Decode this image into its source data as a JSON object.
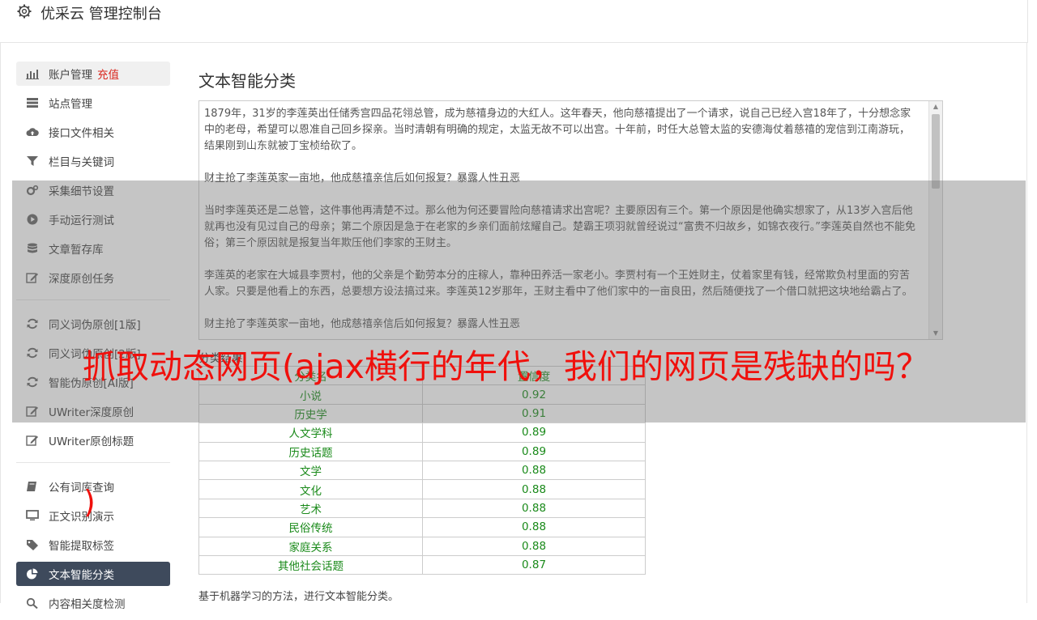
{
  "header": {
    "title": "优采云 管理控制台"
  },
  "sidebar": {
    "group1": [
      {
        "label": "账户管理",
        "extra": "充值",
        "icon": "bar-chart-icon"
      },
      {
        "label": "站点管理",
        "icon": "server-icon"
      },
      {
        "label": "接口文件相关",
        "icon": "cloud-upload-icon"
      },
      {
        "label": "栏目与关键词",
        "icon": "filter-icon"
      },
      {
        "label": "采集细节设置",
        "icon": "gears-icon"
      },
      {
        "label": "手动运行测试",
        "icon": "play-icon"
      },
      {
        "label": "文章暂存库",
        "icon": "database-icon"
      },
      {
        "label": "深度原创任务",
        "icon": "edit-icon"
      }
    ],
    "group2": [
      {
        "label": "同义词伪原创[1版]",
        "icon": "refresh-icon"
      },
      {
        "label": "同义词伪原创[2版]",
        "icon": "refresh-icon"
      },
      {
        "label": "智能伪原创[AI版]",
        "icon": "refresh-icon"
      },
      {
        "label": "UWriter深度原创",
        "icon": "edit-icon"
      },
      {
        "label": "UWriter原创标题",
        "icon": "edit-icon"
      }
    ],
    "group3": [
      {
        "label": "公有词库查询",
        "icon": "book-icon"
      },
      {
        "label": "正文识别演示",
        "icon": "monitor-icon"
      },
      {
        "label": "智能提取标签",
        "icon": "tag-icon"
      },
      {
        "label": "文本智能分类",
        "icon": "pie-chart-icon"
      },
      {
        "label": "内容相关度检测",
        "icon": "search-icon"
      }
    ]
  },
  "main": {
    "title": "文本智能分类",
    "text_paragraphs": [
      "1879年，31岁的李莲英出任储秀宫四品花翎总管，成为慈禧身边的大红人。这年春天，他向慈禧提出了一个请求，说自己已经入宫18年了，十分想念家中的老母，希望可以恩准自己回乡探亲。当时清朝有明确的规定，太监无故不可以出宫。十年前，时任大总管太监的安德海仗着慈禧的宠信到江南游玩，结果刚到山东就被丁宝桢给砍了。",
      "财主抢了李莲英家一亩地，他成慈禧亲信后如何报复？暴露人性丑恶",
      "当时李莲英还是二总管，这件事他再清楚不过。那么他为何还要冒险向慈禧请求出宫呢？主要原因有三个。第一个原因是他确实想家了，从13岁入宫后他就再也没有见过自己的母亲；第二个原因是急于在老家的乡亲们面前炫耀自己。楚霸王项羽就曾经说过“富贵不归故乡，如锦衣夜行。”李莲英自然也不能免俗；第三个原因就是报复当年欺压他们李家的王财主。",
      "李莲英的老家在大城县李贾村，他的父亲是个勤劳本分的庄稼人，靠种田养活一家老小。李贾村有一个王姓财主，仗着家里有钱，经常欺负村里面的穷苦人家。只要是他看上的东西，总要想方设法搞过来。李莲英12岁那年，王财主看中了他们家中的一亩良田，然后随便找了一个借口就把这块地给霸占了。",
      "财主抢了李莲英家一亩地，他成慈禧亲信后如何报复？暴露人性丑恶"
    ],
    "table": {
      "caption": "分类结果",
      "headers": [
        "分类名",
        "置信度"
      ],
      "rows": [
        {
          "cat": "小说",
          "val": "0.92"
        },
        {
          "cat": "历史学",
          "val": "0.91"
        },
        {
          "cat": "人文学科",
          "val": "0.89"
        },
        {
          "cat": "历史话题",
          "val": "0.89"
        },
        {
          "cat": "文学",
          "val": "0.88"
        },
        {
          "cat": "文化",
          "val": "0.88"
        },
        {
          "cat": "艺术",
          "val": "0.88"
        },
        {
          "cat": "民俗传统",
          "val": "0.88"
        },
        {
          "cat": "家庭关系",
          "val": "0.88"
        },
        {
          "cat": "其他社会话题",
          "val": "0.87"
        }
      ]
    },
    "note": "基于机器学习的方法，进行文本智能分类。"
  },
  "overlay": {
    "headline": "抓取动态网页(ajax横行的年代，我们的网页是残缺的吗？",
    "paren": ")"
  },
  "colors": {
    "accent": "#3e4a5c",
    "recharge": "#d9261c",
    "result_green": "#1a8a1a",
    "overlay_red": "#f0100c"
  }
}
